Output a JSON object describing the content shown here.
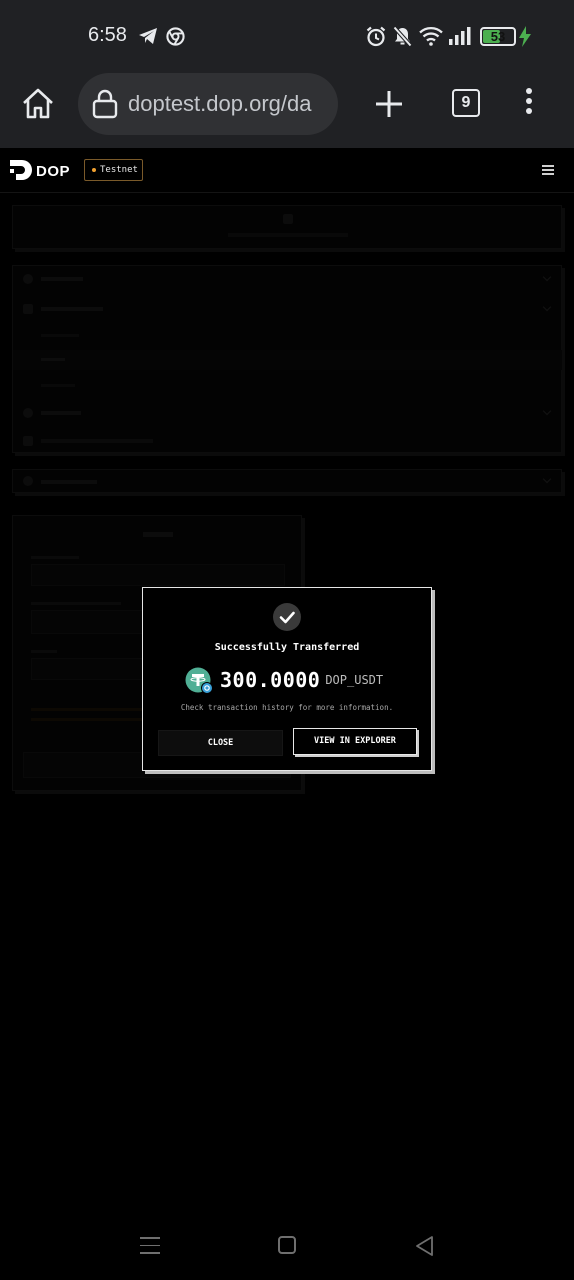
{
  "status_bar": {
    "time": "6:58",
    "battery_level": "53",
    "icons": [
      "telegram-icon",
      "chrome-icon",
      "alarm-icon",
      "mute-icon",
      "wifi-icon",
      "signal-icon",
      "battery-icon",
      "charging-icon"
    ]
  },
  "browser": {
    "url": "doptest.dop.org/da",
    "tab_count": "9",
    "icons": [
      "home-icon",
      "lock-icon",
      "new-tab-icon",
      "tabs-icon",
      "more-icon"
    ]
  },
  "app_header": {
    "logo_text": "DOP",
    "network_badge": "Testnet",
    "colors": {
      "badge_dot": "#f0a030"
    }
  },
  "modal": {
    "title": "Successfully Transferred",
    "amount": "300.0000",
    "symbol": "DOP_USDT",
    "hint": "Check transaction history for more information.",
    "close_label": "CLOSE",
    "explorer_label": "VIEW IN EXPLORER",
    "colors": {
      "token": "#50af95",
      "token_badge": "#3aa0d8"
    }
  },
  "nav_bar": {
    "icons": [
      "recents-icon",
      "home-nav-icon",
      "back-icon"
    ]
  }
}
